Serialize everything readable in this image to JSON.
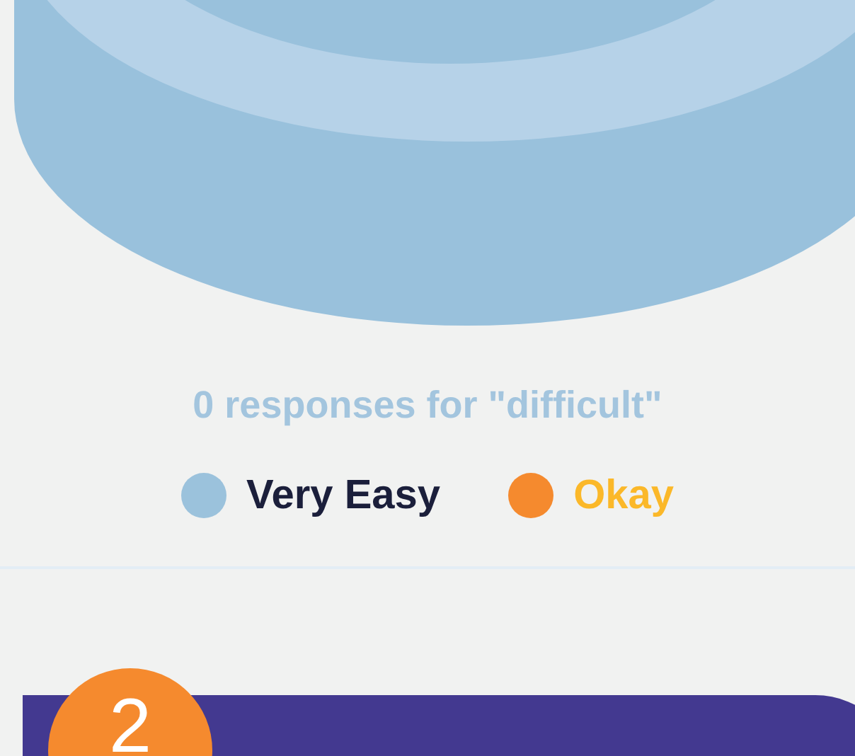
{
  "chart": {
    "caption": "0 responses for \"difficult\""
  },
  "legend": [
    {
      "label": "Very Easy",
      "color": "#9bc2dc",
      "highlighted": false
    },
    {
      "label": "Okay",
      "color": "#f58a2e",
      "highlighted": true
    }
  ],
  "next_card": {
    "badge": "2"
  }
}
